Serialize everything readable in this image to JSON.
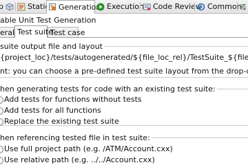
{
  "top_tabs": [
    {
      "label": "p",
      "icon": "cube-icon"
    },
    {
      "label": "Static",
      "icon": "static-analysis-icon"
    },
    {
      "label": "Generation",
      "icon": "generation-icon"
    },
    {
      "label": "Execution",
      "icon": "execution-icon"
    },
    {
      "label": "Code Review",
      "icon": "code-review-icon"
    },
    {
      "label": "Common",
      "icon": "common-icon"
    }
  ],
  "enable_label": "able Unit Test Generation",
  "inner_tabs": [
    {
      "label": "eral"
    },
    {
      "label": "Test suite"
    },
    {
      "label": "Test case"
    }
  ],
  "output_section": {
    "title": "suite output file and layout",
    "path_value": "{project_loc}/tests/autogenerated/${file_loc_rel}/TestSuite_${file_base_name}_${file_ext}",
    "hint": "nt: you can choose a pre-defined test suite layout from the drop-down list"
  },
  "existing_section": {
    "title": "hen generating tests for code with an existing test suite:",
    "options": [
      {
        "label": "Add tests for functions without tests",
        "checked": false
      },
      {
        "label": "Add tests for all functions",
        "checked": false
      },
      {
        "label": "Replace the existing test suite",
        "checked": false
      }
    ]
  },
  "reference_section": {
    "title": "hen referencing tested file in test suite:",
    "options": [
      {
        "label": "Use full project path (e.g. /ATM/Account.cxx)",
        "checked": false
      },
      {
        "label": "Use relative path (e.g. ../../Account.cxx)",
        "checked": false
      }
    ]
  },
  "colors": {
    "generation_icon_orange": "#e07b18",
    "execution_icon_green": "#2f9a2f",
    "common_icon_blue": "#2d6cc0"
  }
}
